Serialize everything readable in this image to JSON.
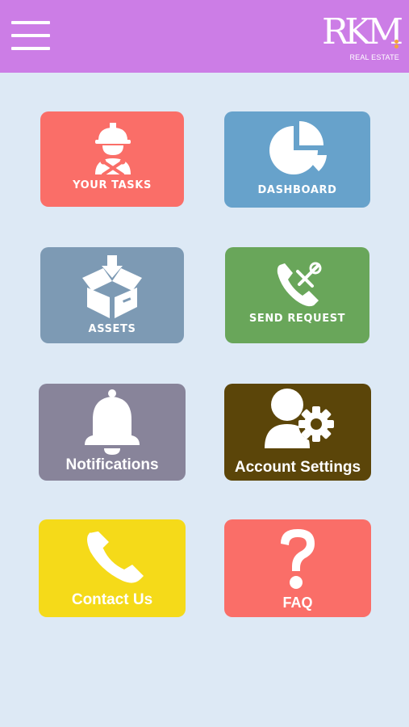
{
  "header": {
    "menu_icon": "hamburger-menu-icon",
    "background": "#cc7de6",
    "logo": {
      "mark": "RKM",
      "subtitle": "REAL ESTATE"
    }
  },
  "tiles": [
    {
      "label": "YOUR TASKS",
      "icon": "worker-tools-icon",
      "color": "#fa6e68"
    },
    {
      "label": "DASHBOARD",
      "icon": "pie-chart-icon",
      "color": "#67a2cb"
    },
    {
      "label": "ASSETS",
      "icon": "box-download-icon",
      "color": "#7d9ab4"
    },
    {
      "label": "SEND REQUEST",
      "icon": "phone-tools-icon",
      "color": "#69a65a"
    },
    {
      "label": "Notifications",
      "icon": "bell-icon",
      "color": "#88849a"
    },
    {
      "label": "Account Settings",
      "icon": "user-gear-icon",
      "color": "#5b4509"
    },
    {
      "label": "Contact Us",
      "icon": "phone-icon",
      "color": "#f5da19"
    },
    {
      "label": "FAQ",
      "icon": "question-mark-icon",
      "color": "#fa6e68"
    }
  ]
}
